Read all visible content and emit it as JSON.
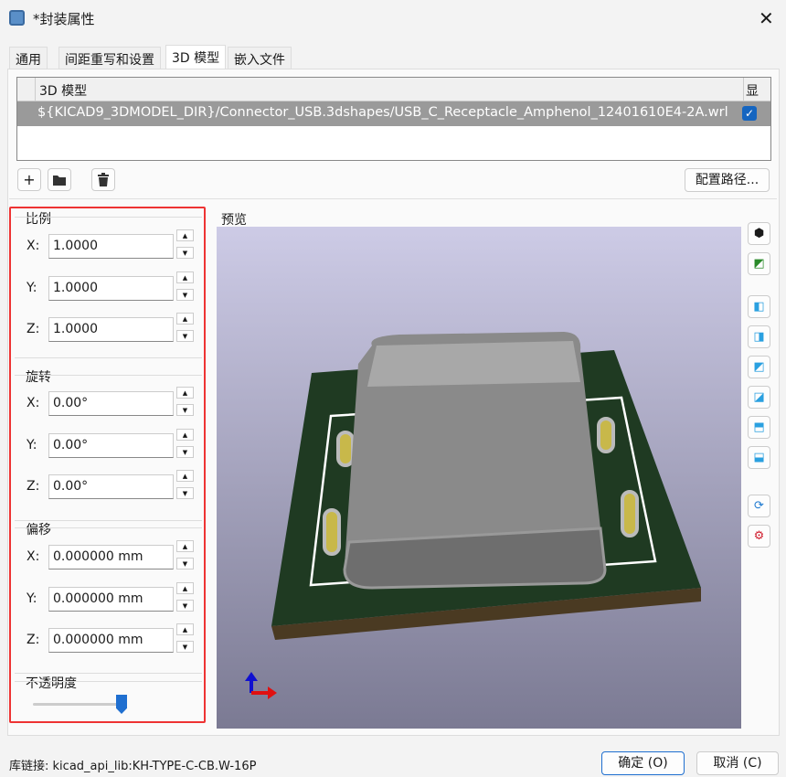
{
  "window": {
    "title": "*封装属性",
    "close": "✕"
  },
  "tabs": [
    "通用",
    "间距重写和设置",
    "3D 模型",
    "嵌入文件"
  ],
  "model_table": {
    "headers": [
      "3D 模型",
      "显示"
    ],
    "rows": [
      {
        "path": "${KICAD9_3DMODEL_DIR}/Connector_USB.3dshapes/USB_C_Receptacle_Amphenol_12401610E4-2A.wrl",
        "show": true
      }
    ]
  },
  "buttons": {
    "add": "+",
    "configure_paths": "配置路径...",
    "ok": "确定 (O)",
    "cancel": "取消 (C)"
  },
  "scale": {
    "title": "比例",
    "x_label": "X:",
    "y_label": "Y:",
    "z_label": "Z:",
    "x": "1.0000",
    "y": "1.0000",
    "z": "1.0000"
  },
  "rotation": {
    "title": "旋转",
    "x_label": "X:",
    "y_label": "Y:",
    "z_label": "Z:",
    "x": "0.00°",
    "y": "0.00°",
    "z": "0.00°"
  },
  "offset": {
    "title": "偏移",
    "x_label": "X:",
    "y_label": "Y:",
    "z_label": "Z:",
    "x": "0.000000 mm",
    "y": "0.000000 mm",
    "z": "0.000000 mm"
  },
  "opacity": {
    "title": "不透明度",
    "value": 1.0
  },
  "preview": {
    "title": "预览"
  },
  "footer": {
    "lib_link_label": "库链接:",
    "lib_link": "kicad_api_lib:KH-TYPE-C-CB.W-16P"
  }
}
